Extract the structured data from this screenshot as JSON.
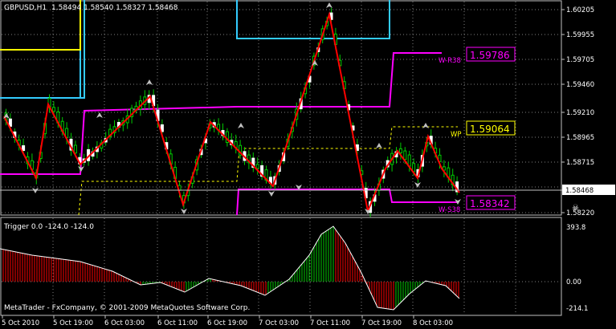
{
  "main_chart": {
    "header": {
      "symbol_timeframe": "GBPUSD,H1",
      "ohlc": "1.58494 1.58540 1.58327 1.58468"
    },
    "price_axis": [
      "1.60205",
      "1.59955",
      "1.59705",
      "1.59460",
      "1.59210",
      "1.58965",
      "1.58715",
      "1.58468",
      "1.58220"
    ],
    "current_price": "1.58468",
    "level_boxes": [
      {
        "label": "W-R38",
        "value": "1.59786",
        "color": "#ff00ff"
      },
      {
        "label": "WP",
        "value": "1.59064",
        "color": "#ffff00"
      },
      {
        "label": "W-S38",
        "value": "1.58342",
        "color": "#ff00ff"
      }
    ]
  },
  "indicator": {
    "title": "Trigger 0.0 -124.0 -124.0",
    "axis": [
      "393.8",
      "0.00",
      "-214.1"
    ],
    "copyright": "MetaTrader - FxCompany, © 2001-2009 MetaQuotes Software Corp."
  },
  "time_axis": [
    "5 Oct 2010",
    "5 Oct 19:00",
    "6 Oct 03:00",
    "6 Oct 11:00",
    "6 Oct 19:00",
    "7 Oct 03:00",
    "7 Oct 11:00",
    "7 Oct 19:00",
    "8 Oct 03:00"
  ],
  "colors": {
    "up_candle": "#ffffff",
    "bull": "#00cc00",
    "bear": "#ff0000",
    "zigzag": "#ff0000",
    "cyan_band": "#33ccff",
    "magenta_band": "#ff00ff",
    "yellow_band": "#ffff00",
    "grid": "#c0c0c0"
  }
}
